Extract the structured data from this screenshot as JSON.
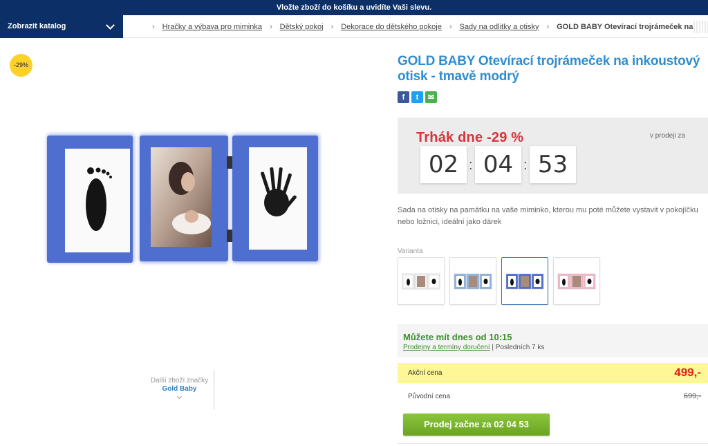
{
  "promo_bar": "Vložte zboží do košíku a uvidíte Vaši slevu.",
  "catalog_button": "Zobrazit katalog",
  "breadcrumb": {
    "items": [
      "Hračky a výbava pro miminka",
      "Dětský pokoj",
      "Dekorace do dětského pokoje",
      "Sady na odlitky a otisky"
    ],
    "current": "GOLD BABY Otevírací trojrámeček na inkoustový otisk - tmavě modrý"
  },
  "discount_badge": "-29%",
  "brand": {
    "label": "Další zboží značky",
    "name": "Gold Baby"
  },
  "product": {
    "title": "GOLD BABY Otevírací trojrámeček na inkoustový otisk - tmavě modrý",
    "description": "Sada na otisky na památku na vaše miminko, kterou mu poté můžete vystavit v pokojíčku nebo ložnici, ideální jako dárek"
  },
  "social": {
    "facebook": "f",
    "twitter": "t",
    "email": "✉"
  },
  "deal": {
    "title": "Trhák dne -29 %",
    "sale_label": "v prodeji za",
    "countdown": {
      "hours": "02",
      "minutes": "04",
      "seconds": "53"
    }
  },
  "variants": {
    "label": "Varianta",
    "items": [
      {
        "frame_color": "#f2f2f2",
        "selected": false
      },
      {
        "frame_color": "#8fb3e0",
        "selected": false
      },
      {
        "frame_color": "#4f6fd0",
        "selected": true
      },
      {
        "frame_color": "#f2b7c4",
        "selected": false
      }
    ]
  },
  "availability": {
    "headline": "Můžete mít dnes od 10:15",
    "link": "Prodejny a termíny doručení",
    "stock": "| Posledních 7 ks"
  },
  "prices": {
    "action_label": "Akční cena",
    "action_value": "499,-",
    "original_label": "Původní cena",
    "original_value": "699,-"
  },
  "buy_button": "Prodej začne za 02 04 53",
  "colors": {
    "navy": "#0b2f66",
    "accent_blue": "#2f8dd0",
    "deal_red": "#d6333a",
    "green": "#6aa321",
    "frame_blue": "#4f6fd0"
  }
}
